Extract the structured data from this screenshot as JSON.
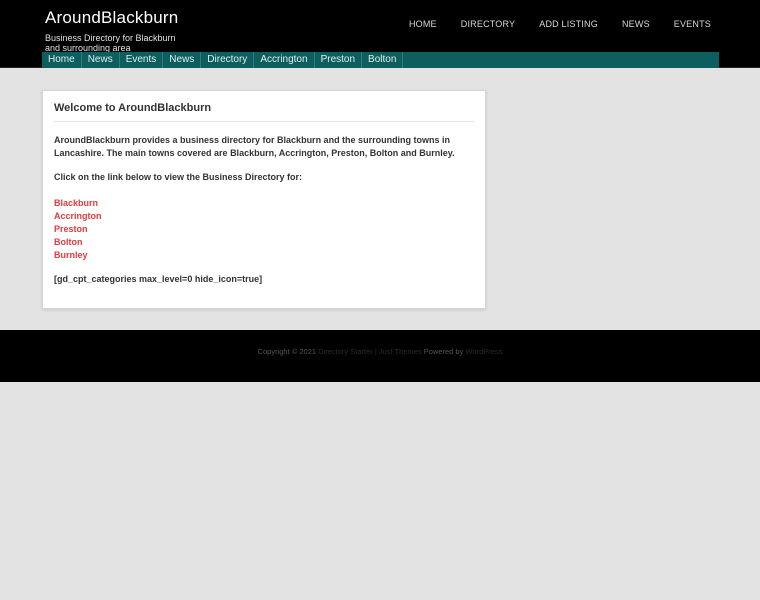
{
  "header": {
    "site_title": "AroundBlackburn",
    "site_description": "Business Directory for Blackburn and surrounding area",
    "top_nav": [
      "HOME",
      "DIRECTORY",
      "ADD LISTING",
      "NEWS",
      "EVENTS"
    ]
  },
  "subnav": [
    "Home",
    "News",
    "Events",
    "News",
    "Directory",
    "Accrington",
    "Preston",
    "Bolton"
  ],
  "content": {
    "title": "Welcome to AroundBlackburn",
    "intro": "AroundBlackburn provides a business directory for Blackburn and the surrounding towns in Lancashire. The main towns covered are Blackburn, Accrington, Preston, Bolton and Burnley.",
    "click_text": "Click on the link below to view the Business Directory for:",
    "links": [
      "Blackburn",
      "Accrington",
      "Preston",
      "Bolton",
      "Burnley"
    ],
    "shortcode": "[gd_cpt_categories max_level=0 hide_icon=true]"
  },
  "footer": {
    "copyright": "Copyright © 2021",
    "theme_link": "Directory Starter | Just Themes",
    "powered_by": "Powered by",
    "wp_link": "WordPress"
  },
  "colors": {
    "header_bg": "#000000",
    "subnav_bg": "#0d5f5f",
    "link_red": "#e23b3b",
    "page_bg": "#e3e3e3"
  }
}
